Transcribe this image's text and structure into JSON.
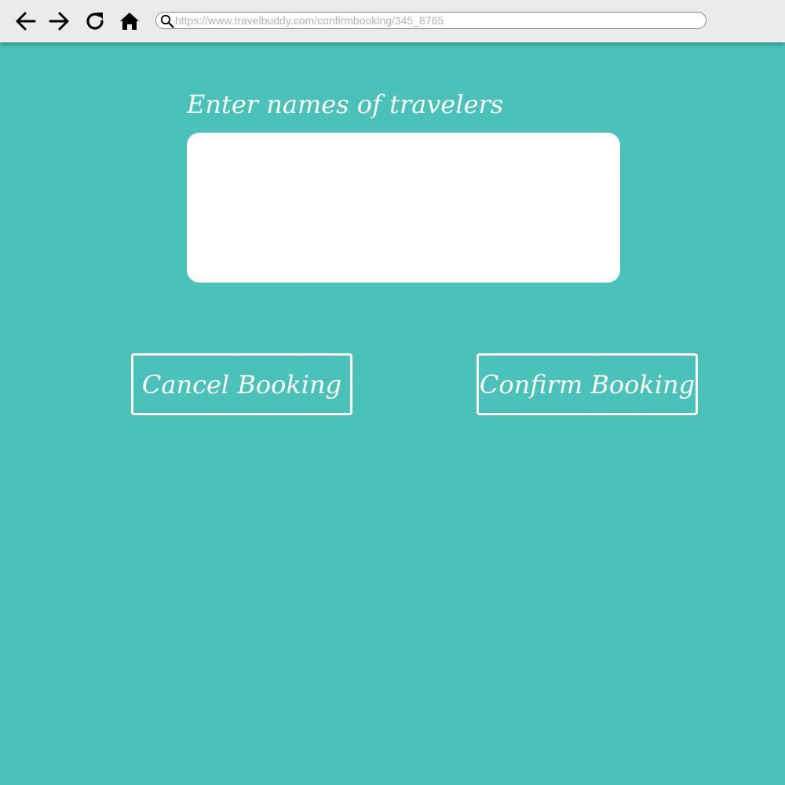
{
  "browser": {
    "url": "https://www.travelbuddy.com/confirmbooking/345_8765",
    "icons": {
      "back": "arrow-left-icon",
      "forward": "arrow-right-icon",
      "reload": "reload-icon",
      "home": "home-icon",
      "search": "search-icon"
    }
  },
  "form": {
    "label": "Enter names of travelers",
    "input_value": ""
  },
  "actions": {
    "cancel_label": "Cancel Booking",
    "confirm_label": "Confirm Booking"
  },
  "colors": {
    "background": "#4ac2ba",
    "toolbar": "#ebebeb",
    "text": "#ffffff"
  }
}
